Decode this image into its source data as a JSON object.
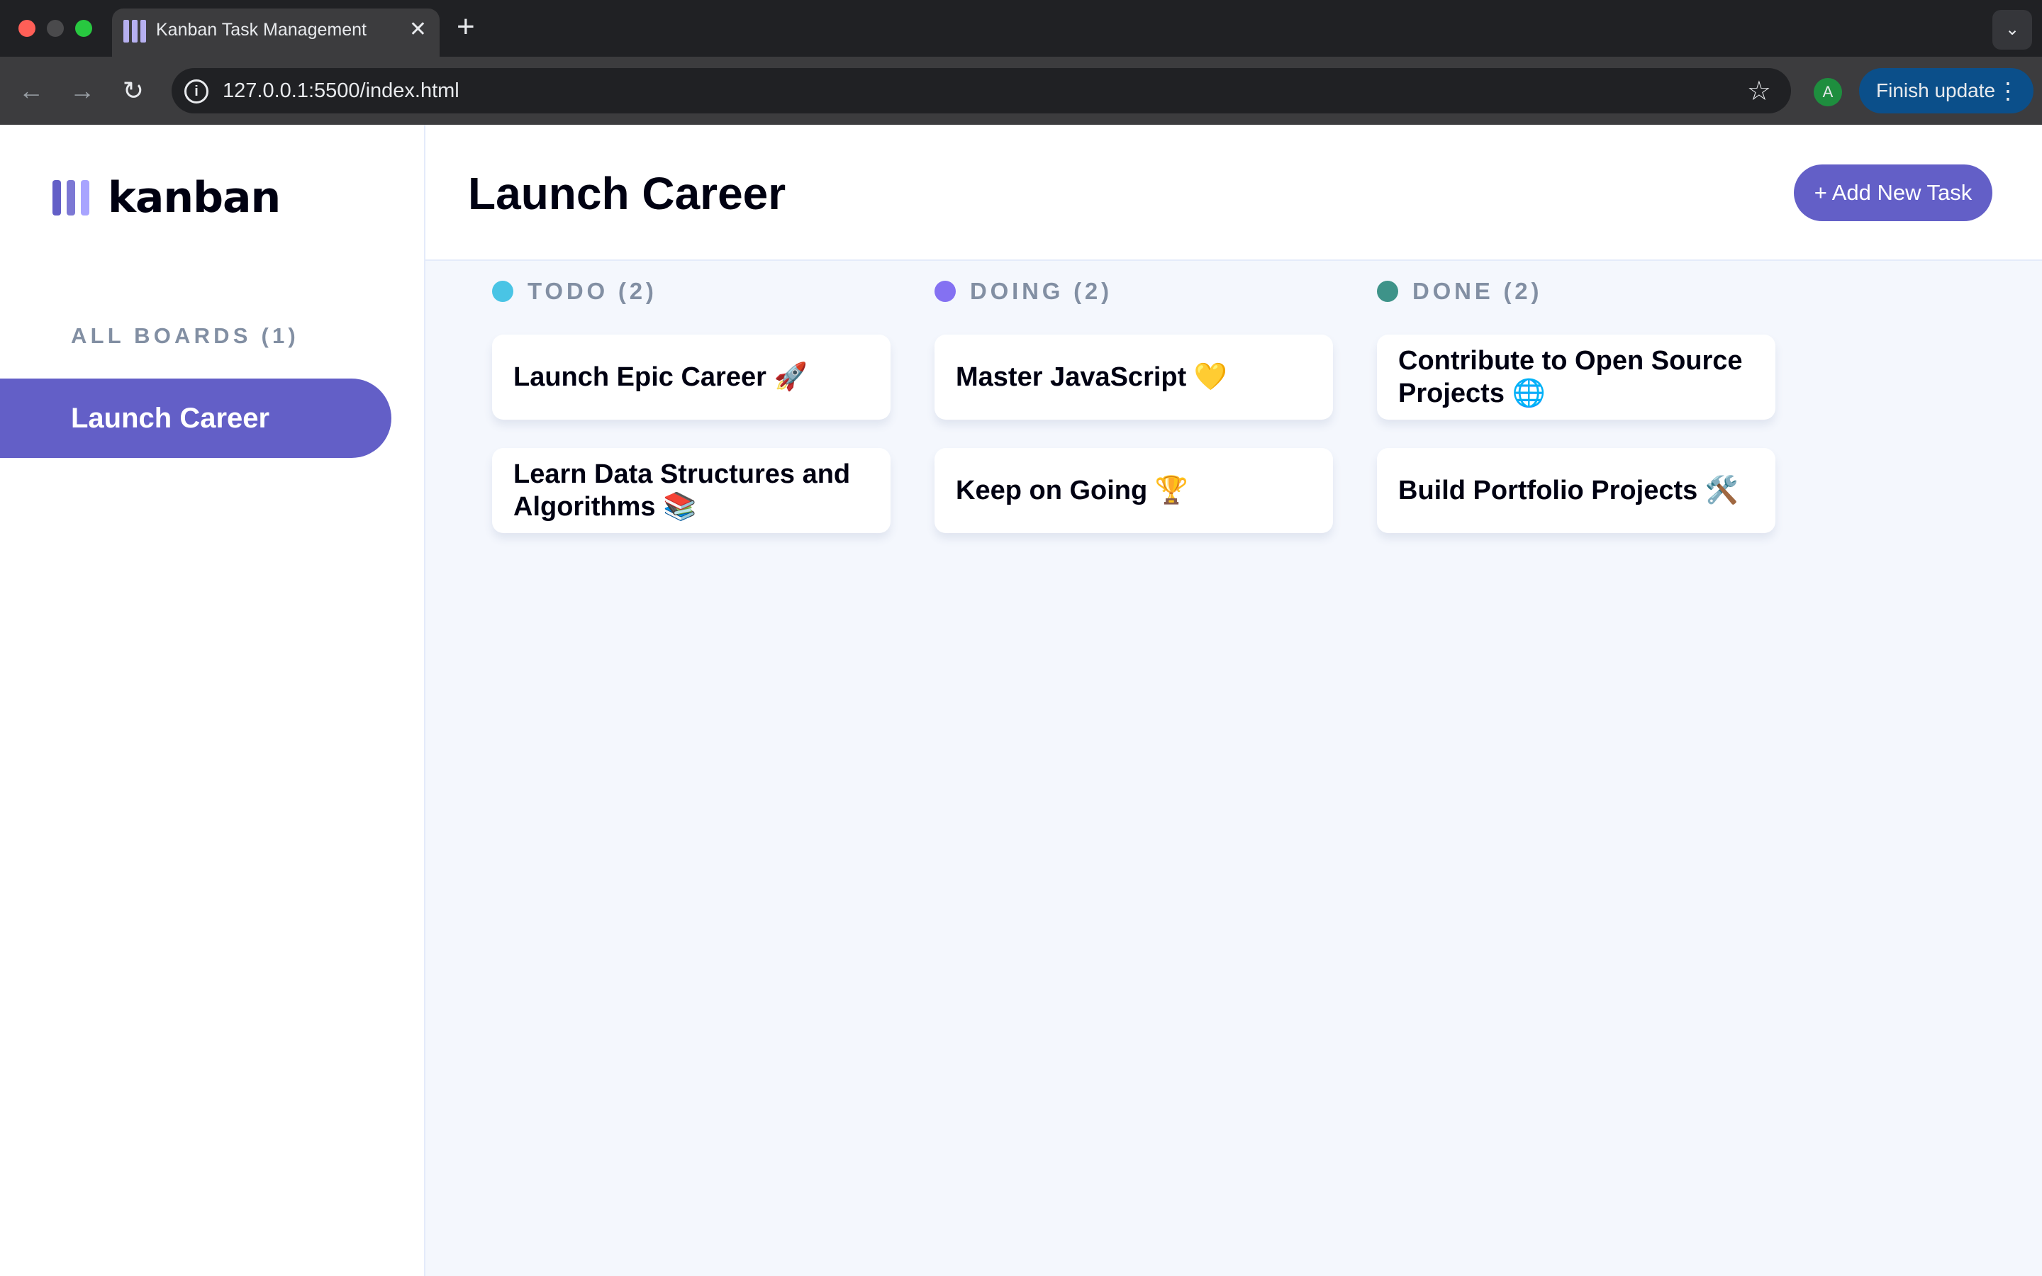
{
  "browser": {
    "tab_title": "Kanban Task Management",
    "tab_close": "✕",
    "new_tab": "+",
    "tab_menu": "⌄",
    "url": "127.0.0.1:5500/index.html",
    "profile_initial": "A",
    "finish_update": "Finish update",
    "menu_dots": "⋮",
    "back": "←",
    "forward": "→",
    "reload": "↻",
    "star": "☆",
    "info": "i",
    "traffic_colors": [
      "#ff5f57",
      "#4a4a4c",
      "#28c840"
    ]
  },
  "sidebar": {
    "logo_text": "kanban",
    "logo_bar_colors": [
      "#635fc7",
      "#7c78d4",
      "#a8a4ff"
    ],
    "boards_heading": "ALL BOARDS (1)",
    "boards": [
      {
        "label": "Launch Career",
        "active": true
      }
    ]
  },
  "header": {
    "board_title": "Launch Career",
    "add_task_label": "+ Add New Task"
  },
  "columns": [
    {
      "label": "TODO (2)",
      "dot_color": "#49c4e5",
      "cards": [
        "Launch Epic Career 🚀",
        "Learn Data Structures and Algorithms 📚"
      ]
    },
    {
      "label": "DOING (2)",
      "dot_color": "#8471f2",
      "cards": [
        "Master JavaScript 💛",
        "Keep on Going 🏆"
      ]
    },
    {
      "label": "DONE (2)",
      "dot_color": "#3e9389",
      "cards": [
        "Contribute to Open Source Projects 🌐",
        "Build Portfolio Projects 🛠️"
      ]
    }
  ],
  "colors": {
    "accent": "#635fc7",
    "board_bg": "#f4f7fd",
    "muted_text": "#828fa3",
    "dark_text": "#000112"
  }
}
